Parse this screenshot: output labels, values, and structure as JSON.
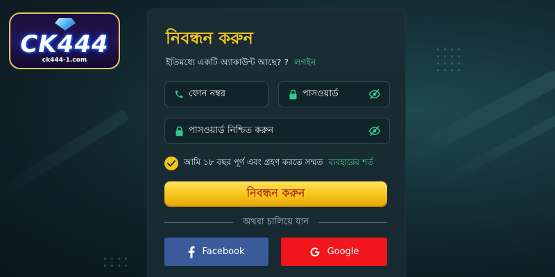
{
  "logo": {
    "brand_text": "CK444",
    "domain_text": "ck444-1.com"
  },
  "form": {
    "title": "নিবন্ধন করুন",
    "subtitle_prefix": "ইতিমধ্যে একটি অ্যাকাউন্ট আছে? ?",
    "login_link": "লগইন",
    "phone_placeholder": "ফোন নম্বর",
    "password_placeholder": "পাসওয়ার্ড",
    "confirm_password_placeholder": "পাসওয়ার্ড নিশ্চিত করুন",
    "agree_text": "আমি ১৮ বছর পূর্ণ এবং গ্রহণ করতে সম্মত",
    "terms_link": "ব্যবহারের শর্ত",
    "agree_checked": true,
    "submit_label": "নিবন্ধন করুন",
    "divider_text": "অথবা চালিয়ে যান",
    "facebook_label": "Facebook",
    "google_label": "Google"
  },
  "icons": {
    "phone": "phone-icon",
    "lock": "lock-icon",
    "eye_off": "eye-off-icon",
    "check": "check-icon",
    "facebook": "facebook-icon",
    "google": "google-icon"
  },
  "colors": {
    "accent_yellow": "#f2c31a",
    "link_green": "#3fd08a",
    "panel_bg": "#1a2d34",
    "facebook_blue": "#3a5a9a",
    "google_red": "#f0161b",
    "submit_text": "#b33b13"
  }
}
